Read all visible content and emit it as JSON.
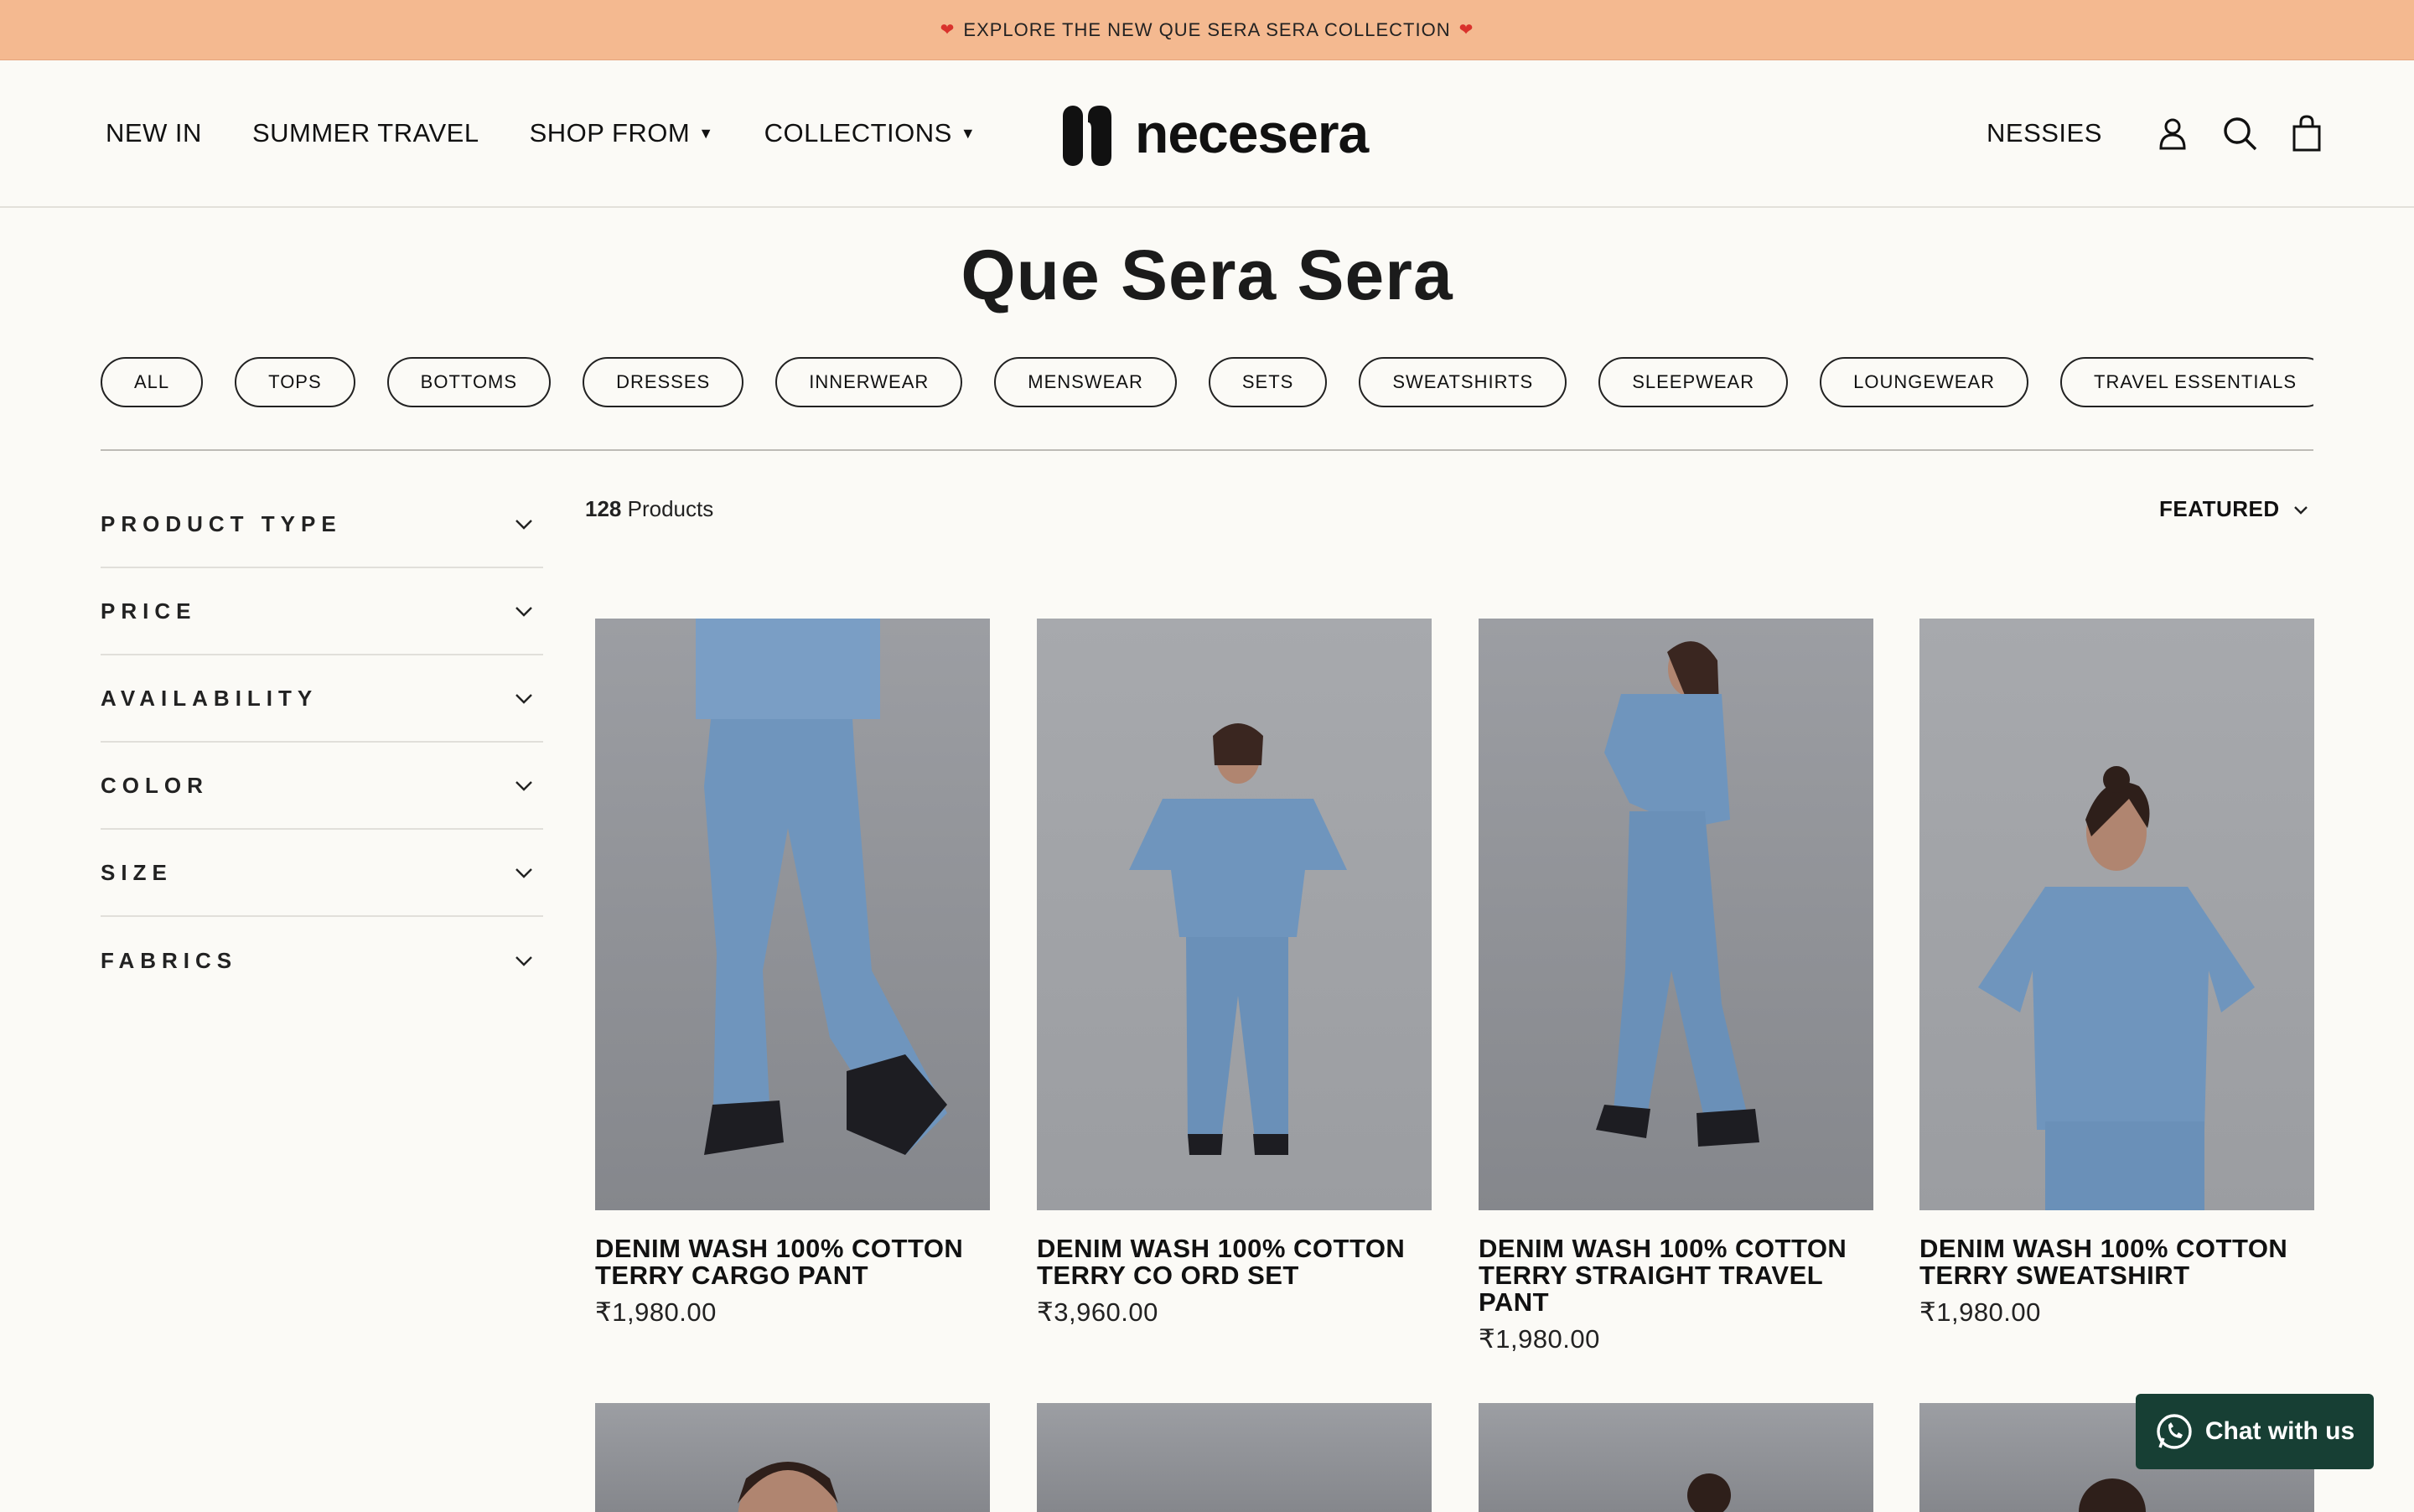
{
  "announcement": {
    "text": "EXPLORE THE NEW QUE SERA SERA COLLECTION"
  },
  "nav": {
    "items": [
      {
        "label": "NEW IN",
        "dropdown": false
      },
      {
        "label": "SUMMER TRAVEL",
        "dropdown": false
      },
      {
        "label": "SHOP FROM",
        "dropdown": true
      },
      {
        "label": "COLLECTIONS",
        "dropdown": true
      }
    ],
    "nessies": "NESSIES"
  },
  "brand": {
    "name": "necesera"
  },
  "page": {
    "title": "Que Sera Sera"
  },
  "categories": [
    "ALL",
    "TOPS",
    "BOTTOMS",
    "DRESSES",
    "INNERWEAR",
    "MENSWEAR",
    "SETS",
    "SWEATSHIRTS",
    "SLEEPWEAR",
    "LOUNGEWEAR",
    "TRAVEL ESSENTIALS"
  ],
  "filters": [
    "PRODUCT TYPE",
    "PRICE",
    "AVAILABILITY",
    "COLOR",
    "SIZE",
    "FABRICS"
  ],
  "toolbar": {
    "count": "128",
    "count_label": "Products",
    "sort_label": "FEATURED"
  },
  "products": [
    {
      "name": "DENIM WASH 100% COTTON TERRY CARGO PANT",
      "price": "₹1,980.00"
    },
    {
      "name": "DENIM WASH 100% COTTON TERRY CO ORD SET",
      "price": "₹3,960.00"
    },
    {
      "name": "DENIM WASH 100% COTTON TERRY STRAIGHT TRAVEL PANT",
      "price": "₹1,980.00"
    },
    {
      "name": "DENIM WASH 100% COTTON TERRY SWEATSHIRT",
      "price": "₹1,980.00"
    }
  ],
  "chat": {
    "label": "Chat with us"
  },
  "colors": {
    "announcement_bg": "#f4b990",
    "chat_bg": "#173f34",
    "page_bg": "#fbfaf6"
  },
  "icons": [
    "account-icon",
    "search-icon",
    "cart-icon",
    "whatsapp-icon"
  ]
}
